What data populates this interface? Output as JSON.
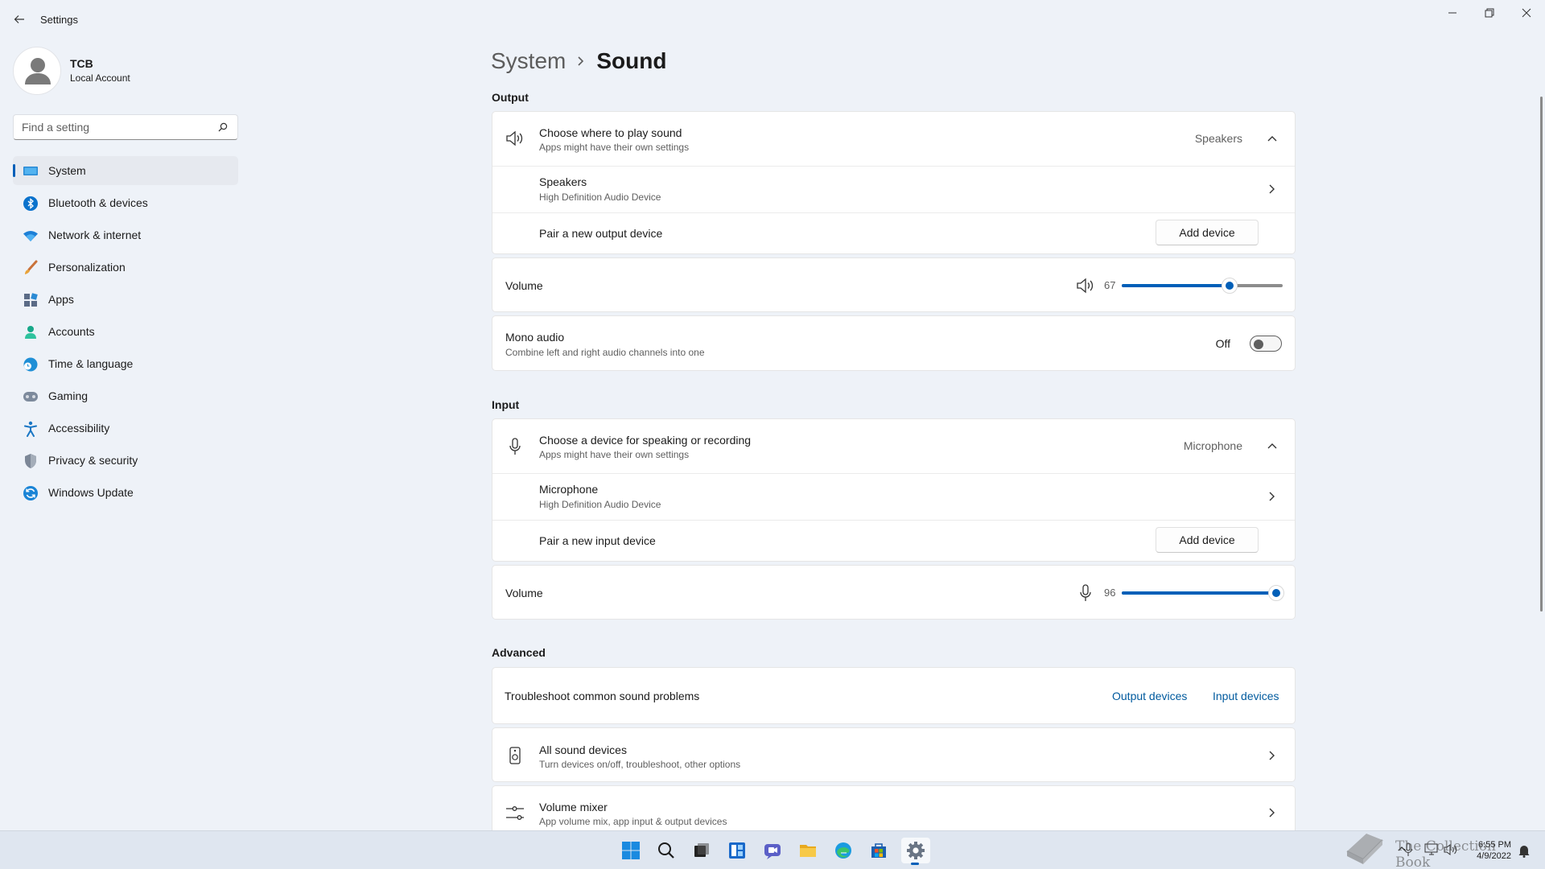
{
  "window": {
    "app_title": "Settings"
  },
  "profile": {
    "name": "TCB",
    "account_type": "Local Account"
  },
  "search": {
    "placeholder": "Find a setting"
  },
  "sidebar": {
    "items": [
      {
        "label": "System",
        "icon": "system-icon",
        "active": true
      },
      {
        "label": "Bluetooth & devices",
        "icon": "bluetooth-icon"
      },
      {
        "label": "Network & internet",
        "icon": "wifi-icon"
      },
      {
        "label": "Personalization",
        "icon": "brush-icon"
      },
      {
        "label": "Apps",
        "icon": "apps-icon"
      },
      {
        "label": "Accounts",
        "icon": "person-icon"
      },
      {
        "label": "Time & language",
        "icon": "globe-clock-icon"
      },
      {
        "label": "Gaming",
        "icon": "gamepad-icon"
      },
      {
        "label": "Accessibility",
        "icon": "accessibility-icon"
      },
      {
        "label": "Privacy & security",
        "icon": "shield-icon"
      },
      {
        "label": "Windows Update",
        "icon": "update-icon"
      }
    ]
  },
  "breadcrumb": {
    "parent": "System",
    "current": "Sound"
  },
  "output": {
    "section_title": "Output",
    "choose_title": "Choose where to play sound",
    "choose_sub": "Apps might have their own settings",
    "choose_value": "Speakers",
    "device_name": "Speakers",
    "device_sub": "High Definition Audio Device",
    "pair_label": "Pair a new output device",
    "add_button": "Add device",
    "volume_label": "Volume",
    "volume_value": "67",
    "volume_level": 67,
    "mono_title": "Mono audio",
    "mono_sub": "Combine left and right audio channels into one",
    "mono_state": "Off"
  },
  "input": {
    "section_title": "Input",
    "choose_title": "Choose a device for speaking or recording",
    "choose_sub": "Apps might have their own settings",
    "choose_value": "Microphone",
    "device_name": "Microphone",
    "device_sub": "High Definition Audio Device",
    "pair_label": "Pair a new input device",
    "add_button": "Add device",
    "volume_label": "Volume",
    "volume_value": "96",
    "volume_level": 96
  },
  "advanced": {
    "section_title": "Advanced",
    "troubleshoot_label": "Troubleshoot common sound problems",
    "output_link": "Output devices",
    "input_link": "Input devices",
    "all_devices_title": "All sound devices",
    "all_devices_sub": "Turn devices on/off, troubleshoot, other options",
    "mixer_title": "Volume mixer",
    "mixer_sub": "App volume mix, app input & output devices"
  },
  "taskbar": {
    "time": "6:55 PM",
    "date": "4/9/2022",
    "watermark": "The Collection Book"
  },
  "colors": {
    "accent": "#005fb8",
    "background": "#eef2f8"
  }
}
